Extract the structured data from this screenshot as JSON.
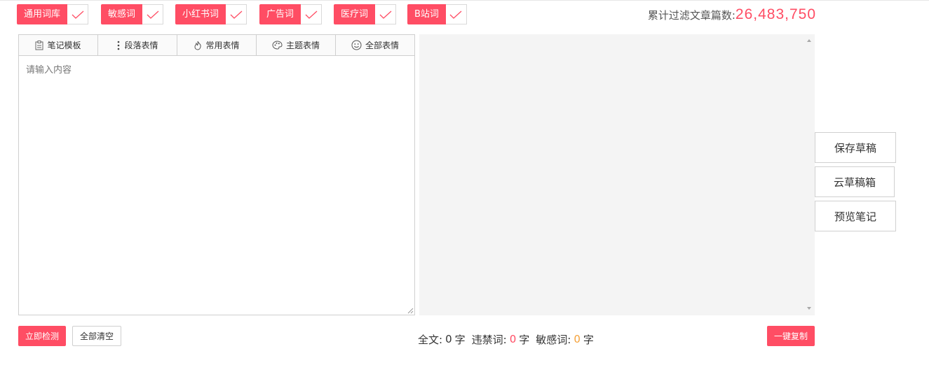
{
  "filters": [
    {
      "label": "通用词库",
      "checked": true
    },
    {
      "label": "敏感词",
      "checked": true
    },
    {
      "label": "小红书词",
      "checked": true
    },
    {
      "label": "广告词",
      "checked": true
    },
    {
      "label": "医疗词",
      "checked": true
    },
    {
      "label": "B站词",
      "checked": true
    }
  ],
  "counter": {
    "label": "累计过滤文章篇数:",
    "value": "26,483,750"
  },
  "toolbar": {
    "note_template": "笔记模板",
    "paragraph_emoji": "段落表情",
    "common_emoji": "常用表情",
    "theme_emoji": "主题表情",
    "all_emoji": "全部表情"
  },
  "editor": {
    "placeholder": "请输入内容",
    "value": ""
  },
  "side_buttons": {
    "save_draft": "保存草稿",
    "cloud_drafts": "云草稿箱",
    "preview_note": "预览笔记"
  },
  "actions": {
    "detect": "立即检测",
    "clear_all": "全部清空",
    "copy": "一键复制"
  },
  "stats": {
    "full_text_label": "全文:",
    "full_text_count": "0",
    "char_unit": "字",
    "banned_label": "违禁词:",
    "banned_count": "0",
    "sensitive_label": "敏感词:",
    "sensitive_count": "0"
  },
  "colors": {
    "accent": "#ff4d64",
    "warning": "#f5a23a",
    "preview_bg": "#f4f4f4"
  }
}
